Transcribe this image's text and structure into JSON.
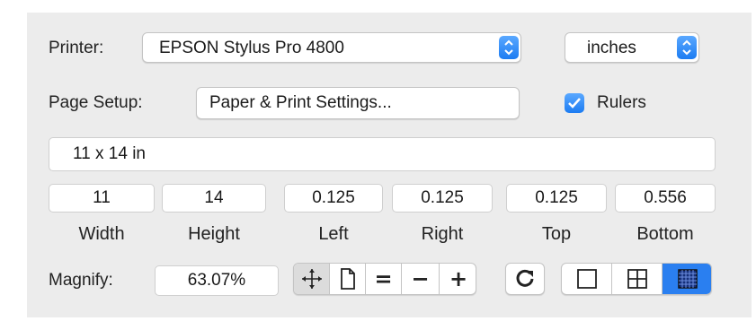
{
  "printer": {
    "label": "Printer:",
    "value": "EPSON Stylus Pro 4800"
  },
  "units": {
    "value": "inches"
  },
  "page_setup": {
    "label": "Page Setup:",
    "button_label": "Paper & Print Settings..."
  },
  "rulers": {
    "label": "Rulers",
    "checked": true
  },
  "paper_size": {
    "value": "11 x 14 in"
  },
  "dimensions": [
    {
      "value": "11",
      "label": "Width"
    },
    {
      "value": "14",
      "label": "Height"
    },
    {
      "value": "0.125",
      "label": "Left"
    },
    {
      "value": "0.125",
      "label": "Right"
    },
    {
      "value": "0.125",
      "label": "Top"
    },
    {
      "value": "0.556",
      "label": "Bottom"
    }
  ],
  "magnify": {
    "label": "Magnify:",
    "value": "63.07%"
  },
  "zoom_tools": [
    "move-icon",
    "page-icon",
    "equals-icon",
    "minus-icon",
    "plus-icon"
  ],
  "grid_tools": [
    "single-page-icon",
    "quad-grid-icon",
    "fine-grid-icon"
  ],
  "colors": {
    "accent": "#2a7ff0",
    "panel": "#ececec"
  }
}
